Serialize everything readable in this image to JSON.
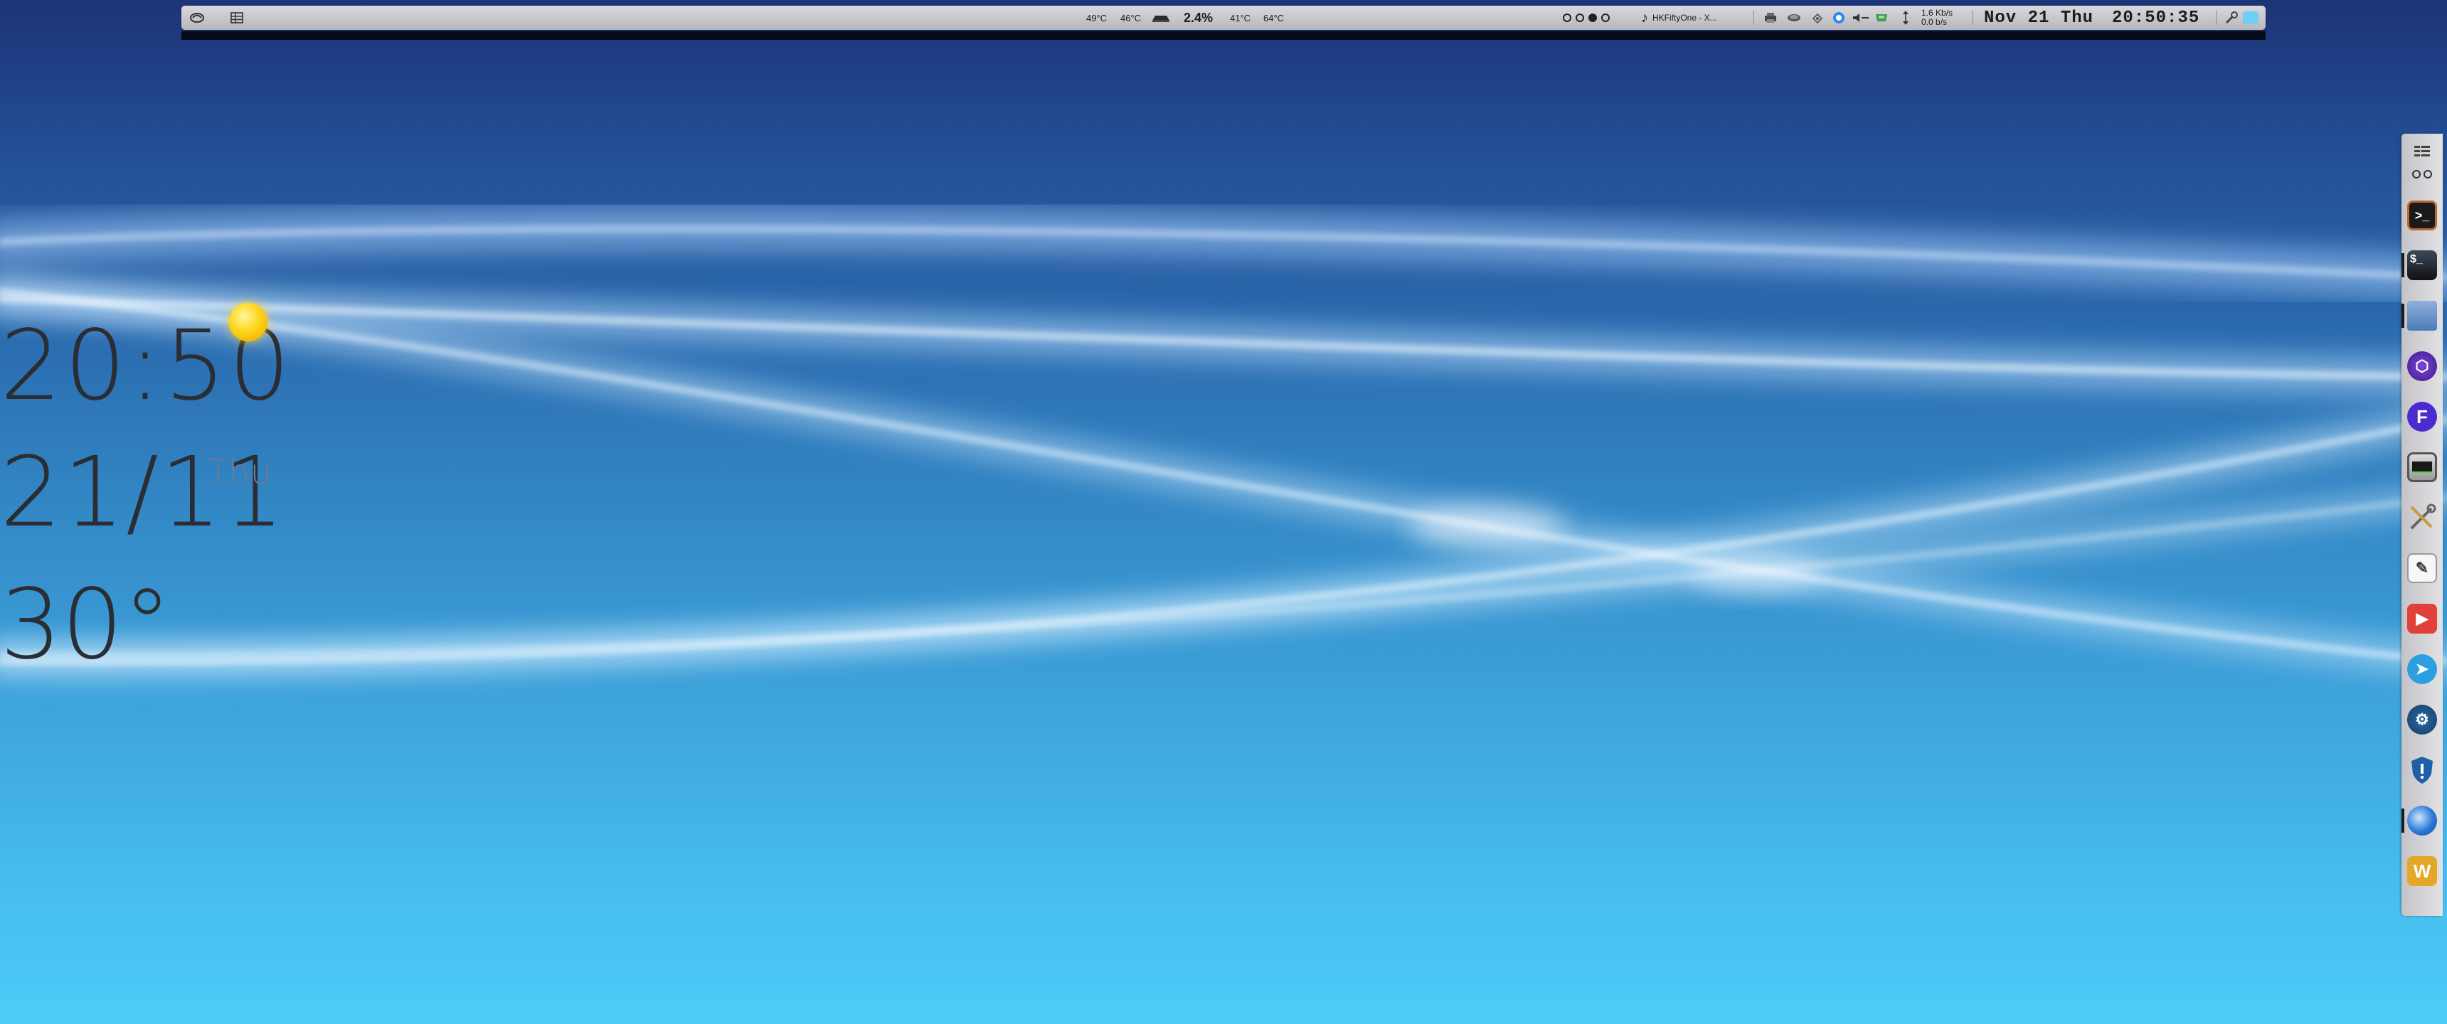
{
  "panel": {
    "temp_1": "49°C",
    "temp_2": "46°C",
    "cpu_usage": "2.4%",
    "temp_3": "41°C",
    "temp_4": "64°C",
    "now_playing": "HKFiftyOne - X...",
    "net_down": "1.6 Kb/s",
    "net_up": "0.0 b/s",
    "date": "Nov 21 Thu",
    "time": "20:50:35",
    "workspaces": [
      {
        "active": false
      },
      {
        "active": false
      },
      {
        "active": true
      },
      {
        "active": false
      }
    ]
  },
  "desklet": {
    "clock": "20:50",
    "day_month": "21/11",
    "day_of_week": "Thu",
    "temperature": "30°",
    "weather_icon": "sun-icon"
  },
  "dock": {
    "items": [
      {
        "name": "app-menu-icon",
        "running": false
      },
      {
        "name": "window-arrange-icon",
        "running": false
      },
      {
        "name": "terminal-dog-icon",
        "running": false
      },
      {
        "name": "terminal-icon",
        "running": true
      },
      {
        "name": "file-manager-icon",
        "running": true
      },
      {
        "name": "hexagon-app-icon",
        "running": false
      },
      {
        "name": "f-app-icon",
        "running": false
      },
      {
        "name": "system-monitor-icon",
        "running": false
      },
      {
        "name": "tools-icon",
        "running": false
      },
      {
        "name": "text-editor-icon",
        "running": false
      },
      {
        "name": "video-player-icon",
        "running": false
      },
      {
        "name": "telegram-icon",
        "running": false
      },
      {
        "name": "steam-icon",
        "running": false
      },
      {
        "name": "shield-app-icon",
        "running": false
      },
      {
        "name": "thunderbird-icon",
        "running": true
      },
      {
        "name": "w-app-icon",
        "running": false
      }
    ]
  },
  "colors": {
    "panel_bg": "#c8c8cc",
    "text_dark": "#2b2d35",
    "sun": "#ffd419",
    "sky_top": "#1d3377",
    "sky_bottom": "#4ccdf8"
  }
}
